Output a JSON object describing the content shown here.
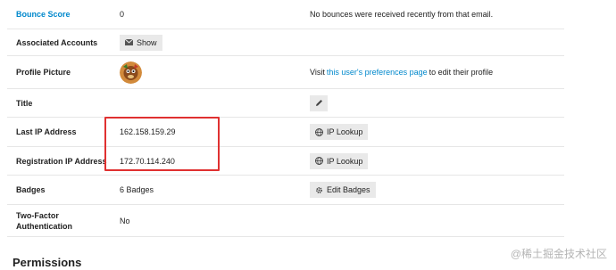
{
  "rows": {
    "bounce_score": {
      "label": "Bounce Score",
      "value": "0",
      "note": "No bounces were received recently from that email."
    },
    "associated_accounts": {
      "label": "Associated Accounts",
      "button": "Show"
    },
    "profile_picture": {
      "label": "Profile Picture",
      "note_prefix": "Visit ",
      "note_link": "this user's preferences page",
      "note_suffix": " to edit their profile"
    },
    "title": {
      "label": "Title"
    },
    "last_ip": {
      "label": "Last IP Address",
      "value": "162.158.159.29",
      "button": "IP Lookup"
    },
    "registration_ip": {
      "label": "Registration IP Address",
      "value": "172.70.114.240",
      "button": "IP Lookup"
    },
    "badges": {
      "label": "Badges",
      "value": "6 Badges",
      "button": "Edit Badges"
    },
    "two_factor": {
      "label": "Two-Factor Authentication",
      "value": "No"
    }
  },
  "section": {
    "permissions_title": "Permissions"
  },
  "watermark": "@稀土掘金技术社区",
  "colors": {
    "link": "#0088cc",
    "highlight": "#e03131",
    "button_bg": "#e9e9e9"
  },
  "icons": {
    "show": "envelope-icon",
    "title_edit": "pencil-icon",
    "ip_lookup": "globe-icon",
    "edit_badges": "gear-icon"
  }
}
